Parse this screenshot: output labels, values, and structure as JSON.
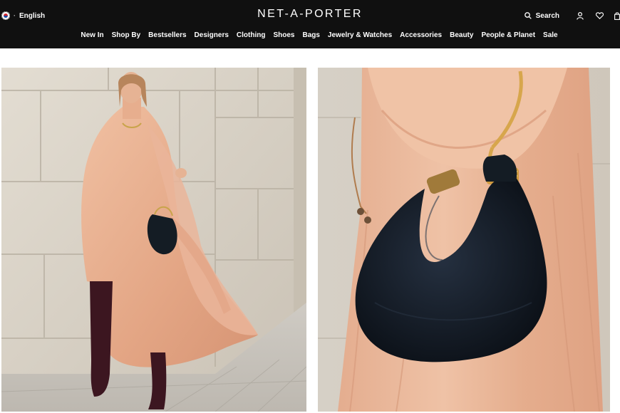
{
  "header": {
    "language": "English",
    "language_separator": "·",
    "logo": "NET-A-PORTER",
    "search_label": "Search",
    "nav": [
      "New In",
      "Shop By",
      "Bestsellers",
      "Designers",
      "Clothing",
      "Shoes",
      "Bags",
      "Jewelry & Watches",
      "Accessories",
      "Beauty",
      "People & Planet",
      "Sale"
    ]
  },
  "icons": {
    "flag": "korea-flag-icon",
    "search": "search-icon",
    "account": "account-icon",
    "wishlist": "heart-icon",
    "cart": "shopping-bag-icon"
  },
  "colors": {
    "header_bg": "#101010",
    "header_text": "#ffffff",
    "dress": "#e9b294",
    "bag": "#141c24",
    "boots": "#3c1620",
    "stone_wall": "#d9d2c6"
  },
  "images": {
    "left": "model in peach chiffon dress holding a black hobo bag",
    "right": "close-up of black suede hobo bag with gold handle"
  }
}
